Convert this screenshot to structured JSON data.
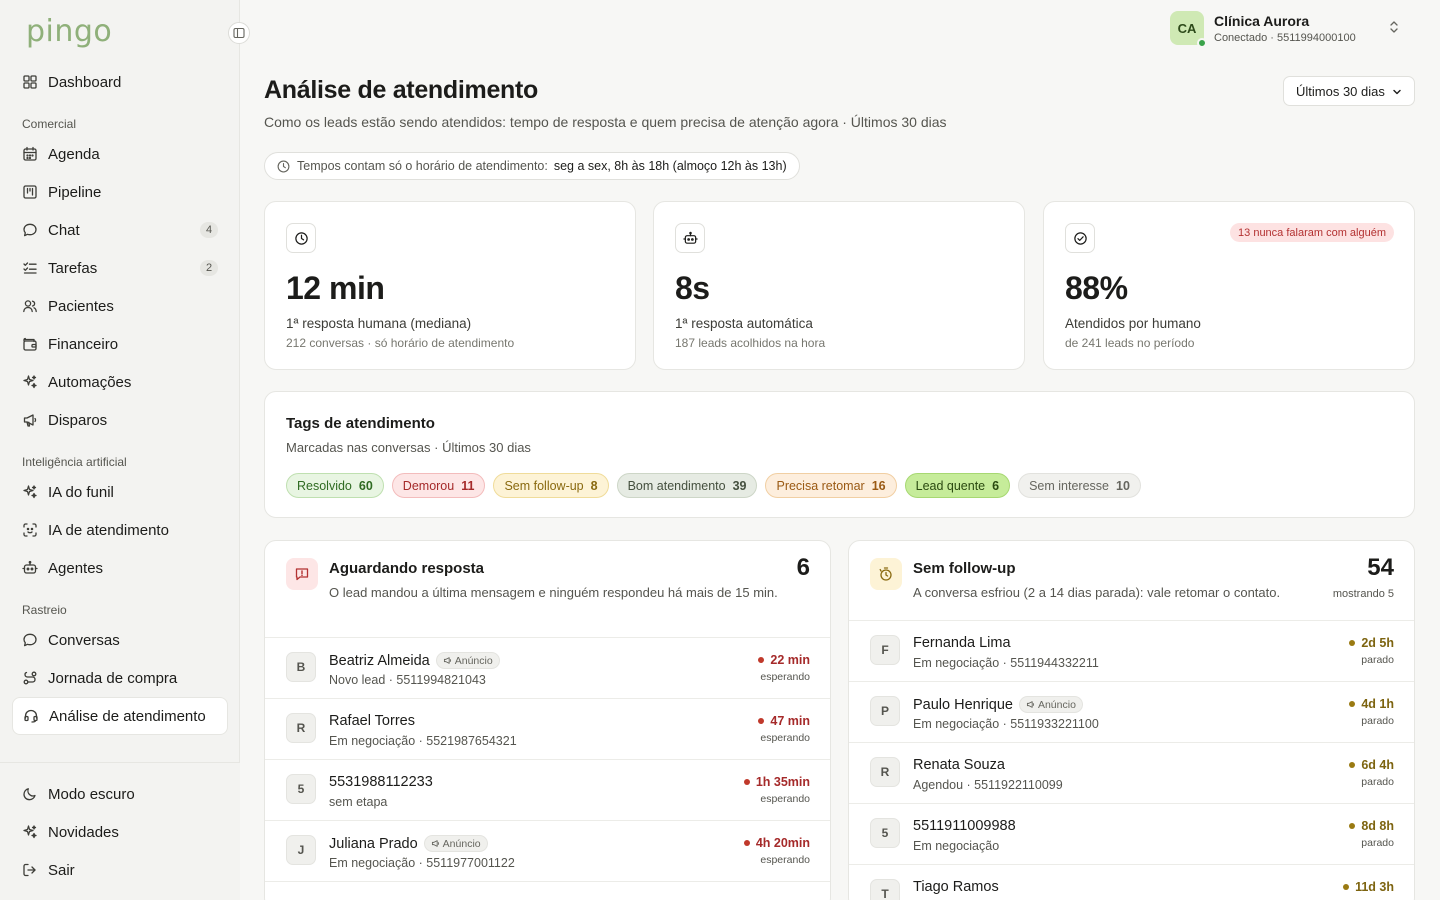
{
  "app": {
    "logo": "pingo"
  },
  "account": {
    "initials": "CA",
    "name": "Clínica Aurora",
    "status": "Conectado · 5511994000100"
  },
  "sidebar": {
    "top": [
      {
        "label": "Dashboard",
        "icon": "grid-icon"
      }
    ],
    "sections": [
      {
        "title": "Comercial",
        "items": [
          {
            "label": "Agenda",
            "icon": "calendar-icon"
          },
          {
            "label": "Pipeline",
            "icon": "kanban-icon"
          },
          {
            "label": "Chat",
            "icon": "chat-bubble-icon",
            "badge": "4"
          },
          {
            "label": "Tarefas",
            "icon": "checklist-icon",
            "badge": "2"
          },
          {
            "label": "Pacientes",
            "icon": "users-icon"
          },
          {
            "label": "Financeiro",
            "icon": "wallet-icon"
          },
          {
            "label": "Automações",
            "icon": "sparkles-icon"
          },
          {
            "label": "Disparos",
            "icon": "megaphone-icon"
          }
        ]
      },
      {
        "title": "Inteligência artificial",
        "items": [
          {
            "label": "IA do funil",
            "icon": "sparkles-icon"
          },
          {
            "label": "IA de atendimento",
            "icon": "scan-face-icon"
          },
          {
            "label": "Agentes",
            "icon": "bot-icon"
          }
        ]
      },
      {
        "title": "Rastreio",
        "items": [
          {
            "label": "Conversas",
            "icon": "chat-bubble-icon"
          },
          {
            "label": "Jornada de compra",
            "icon": "route-icon"
          },
          {
            "label": "Análise de atendimento",
            "icon": "headset-icon",
            "active": true
          }
        ]
      }
    ],
    "bottom": [
      {
        "label": "Modo escuro",
        "icon": "moon-icon"
      },
      {
        "label": "Novidades",
        "icon": "sparkles-icon"
      },
      {
        "label": "Sair",
        "icon": "logout-icon"
      }
    ]
  },
  "header": {
    "title": "Análise de atendimento",
    "subtitle": "Como os leads estão sendo atendidos: tempo de resposta e quem precisa de atenção agora · Últimos 30 dias",
    "period": "Últimos 30 dias",
    "hours_label": "Tempos contam só o horário de atendimento:",
    "hours_value": "seg a sex, 8h às 18h (almoço 12h às 13h)"
  },
  "kpis": [
    {
      "icon": "clock-icon",
      "value": "12 min",
      "label": "1ª resposta humana (mediana)",
      "note": "212 conversas · só horário de atendimento"
    },
    {
      "icon": "bot-icon",
      "value": "8s",
      "label": "1ª resposta automática",
      "note": "187 leads acolhidos na hora"
    },
    {
      "icon": "check-circle-icon",
      "value": "88%",
      "label": "Atendidos por humano",
      "note": "de 241 leads no período",
      "warning": "13 nunca falaram com alguém"
    }
  ],
  "tags": {
    "title": "Tags de atendimento",
    "subtitle": "Marcadas nas conversas · Últimos 30 dias",
    "items": [
      {
        "label": "Resolvido",
        "count": "60",
        "bg": "#e8f5e2",
        "border": "#bfe0b0",
        "color": "#2f6b22"
      },
      {
        "label": "Demorou",
        "count": "11",
        "bg": "#fde6e6",
        "border": "#f3bcbc",
        "color": "#a52a2a"
      },
      {
        "label": "Sem follow-up",
        "count": "8",
        "bg": "#fdf3d6",
        "border": "#f0dc9a",
        "color": "#8a6a10"
      },
      {
        "label": "Bom atendimento",
        "count": "39",
        "bg": "#e6ebe3",
        "border": "#cdd6c7",
        "color": "#45503f"
      },
      {
        "label": "Precisa retomar",
        "count": "16",
        "bg": "#fdeedd",
        "border": "#f1cfa3",
        "color": "#9a5a14"
      },
      {
        "label": "Lead quente",
        "count": "6",
        "bg": "#c6ec9a",
        "border": "#a7d872",
        "color": "#2a4a10"
      },
      {
        "label": "Sem interesse",
        "count": "10",
        "bg": "#f1f1ee",
        "border": "#e2e2de",
        "color": "#66665f"
      }
    ]
  },
  "awaiting": {
    "title": "Aguardando resposta",
    "description": "O lead mandou a última mensagem e ninguém respondeu há mais de 15 min.",
    "count": "6",
    "rows": [
      {
        "initial": "B",
        "name": "Beatriz Almeida",
        "ad": "Anúncio",
        "sub": "Novo lead · 5511994821043",
        "time": "22 min",
        "state": "esperando"
      },
      {
        "initial": "R",
        "name": "Rafael Torres",
        "sub": "Em negociação · 5521987654321",
        "time": "47 min",
        "state": "esperando"
      },
      {
        "initial": "5",
        "name": "5531988112233",
        "sub": "sem etapa",
        "time": "1h 35min",
        "state": "esperando"
      },
      {
        "initial": "J",
        "name": "Juliana Prado",
        "ad": "Anúncio",
        "sub": "Em negociação · 5511977001122",
        "time": "4h 20min",
        "state": "esperando"
      }
    ]
  },
  "followup": {
    "title": "Sem follow-up",
    "description": "A conversa esfriou (2 a 14 dias parada): vale retomar o contato.",
    "count": "54",
    "count_sub": "mostrando 5",
    "rows": [
      {
        "initial": "F",
        "name": "Fernanda Lima",
        "sub": "Em negociação · 5511944332211",
        "time": "2d 5h",
        "state": "parado"
      },
      {
        "initial": "P",
        "name": "Paulo Henrique",
        "ad": "Anúncio",
        "sub": "Em negociação · 5511933221100",
        "time": "4d 1h",
        "state": "parado"
      },
      {
        "initial": "R",
        "name": "Renata Souza",
        "sub": "Agendou · 5511922110099",
        "time": "6d 4h",
        "state": "parado"
      },
      {
        "initial": "5",
        "name": "5511911009988",
        "sub": "Em negociação",
        "time": "8d 8h",
        "state": "parado"
      },
      {
        "initial": "T",
        "name": "Tiago Ramos",
        "sub": "",
        "time": "11d 3h",
        "state": ""
      }
    ]
  },
  "colors": {
    "urgent": "#c0392b",
    "stale": "#9a7a12",
    "accent": "#8fb07a"
  }
}
